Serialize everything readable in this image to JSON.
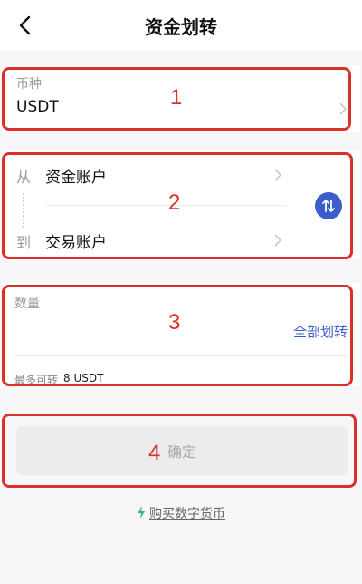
{
  "header": {
    "title": "资金划转"
  },
  "currency": {
    "label": "币种",
    "value": "USDT"
  },
  "transfer": {
    "from_label": "从",
    "from_account": "资金账户",
    "to_label": "到",
    "to_account": "交易账户"
  },
  "amount": {
    "label": "数量",
    "all_button": "全部划转",
    "max_label": "最多可转",
    "max_value": "8 USDT"
  },
  "confirm_label": "确定",
  "buy_link": "购买数字货币",
  "annotations": [
    "1",
    "2",
    "3",
    "4"
  ],
  "colors": {
    "annotation": "#d9302a",
    "accent": "#3a5fcd",
    "bolt": "#3bb37a"
  },
  "icons": {
    "back": "chevron-left-icon",
    "swap": "swap-icon",
    "bolt": "bolt-icon",
    "chevron": "chevron-right-icon"
  }
}
